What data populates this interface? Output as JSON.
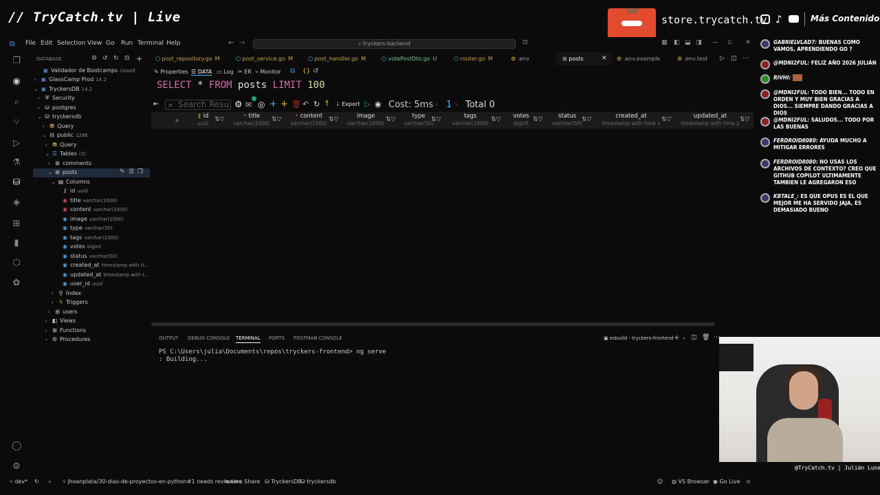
{
  "overlay": {
    "stream_title": "// TryCatch.tv | Live",
    "store_text": "store.trycatch.tv",
    "more_content": "Más Contenido",
    "cam_caption": "@TryCatch.tv | Julián Luna"
  },
  "menu": [
    "File",
    "Edit",
    "Selection",
    "View",
    "Go",
    "Run",
    "Terminal",
    "Help"
  ],
  "search_bar": "tryckers-backend",
  "sidebar": {
    "header": "DATABASE",
    "items": [
      {
        "label": "Validador de Bootcamps",
        "meta": "closed"
      },
      {
        "label": "GlassCamp Prod",
        "meta": "14.2"
      },
      {
        "label": "TryckersDB",
        "meta": "14.2"
      },
      {
        "label": "Security",
        "meta": ""
      },
      {
        "label": "postgres",
        "meta": ""
      },
      {
        "label": "tryckersdb",
        "meta": ""
      },
      {
        "label": "Query",
        "meta": ""
      },
      {
        "label": "public",
        "meta": "128K"
      },
      {
        "label": "Query",
        "meta": ""
      },
      {
        "label": "Tables",
        "meta": "(3)"
      },
      {
        "label": "comments",
        "meta": ""
      },
      {
        "label": "posts",
        "meta": ""
      },
      {
        "label": "Columns",
        "meta": ""
      },
      {
        "label": "id",
        "meta": "uuid"
      },
      {
        "label": "title",
        "meta": "varchar(1000)"
      },
      {
        "label": "content",
        "meta": "varchar(1000)"
      },
      {
        "label": "image",
        "meta": "varchar(1000)"
      },
      {
        "label": "type",
        "meta": "varchar(50)"
      },
      {
        "label": "tags",
        "meta": "varchar(1000)"
      },
      {
        "label": "votes",
        "meta": "bigint"
      },
      {
        "label": "status",
        "meta": "varchar(50)"
      },
      {
        "label": "created_at",
        "meta": "timestamp with ti..."
      },
      {
        "label": "updated_at",
        "meta": "timestamp with t..."
      },
      {
        "label": "user_id",
        "meta": "uuid"
      },
      {
        "label": "Index",
        "meta": ""
      },
      {
        "label": "Triggers",
        "meta": ""
      },
      {
        "label": "users",
        "meta": ""
      },
      {
        "label": "Views",
        "meta": ""
      },
      {
        "label": "Functions",
        "meta": ""
      },
      {
        "label": "Procedures",
        "meta": ""
      }
    ]
  },
  "tabs": [
    {
      "label": "post_repository.go",
      "mod": "M"
    },
    {
      "label": "post_service.go",
      "mod": "M"
    },
    {
      "label": "post_handler.go",
      "mod": "M"
    },
    {
      "label": "votePostDto.go",
      "mod": "U"
    },
    {
      "label": "router.go",
      "mod": "M"
    },
    {
      "label": ".env",
      "mod": ""
    },
    {
      "label": "posts",
      "mod": ""
    },
    {
      "label": ".env.example",
      "mod": ""
    },
    {
      "label": ".env.test",
      "mod": ""
    }
  ],
  "subtabs": [
    "Properties",
    "DATA",
    "Log",
    "ER",
    "Monitor"
  ],
  "sql": {
    "k1": "SELECT",
    "star": "*",
    "k2": "FROM",
    "table": "posts",
    "k3": "LIMIT",
    "limit": "100"
  },
  "result_toolbar": {
    "search_placeholder": "Search Resu",
    "export": "Export",
    "cost": "Cost: 5ms",
    "page": "1",
    "total": "Total 0"
  },
  "columns": [
    {
      "name": "id",
      "type": "uuid"
    },
    {
      "name": "title",
      "type": "varchar(1000)"
    },
    {
      "name": "content",
      "type": "varchar(1000)"
    },
    {
      "name": "image",
      "type": "varchar(1000)"
    },
    {
      "name": "type",
      "type": "varchar(50)"
    },
    {
      "name": "tags",
      "type": "varchar(1000)"
    },
    {
      "name": "votes",
      "type": "bigint"
    },
    {
      "name": "status",
      "type": "varchar(50)"
    },
    {
      "name": "created_at",
      "type": "timestamp with time z"
    },
    {
      "name": "updated_at",
      "type": "timestamp with time z"
    }
  ],
  "panel_tabs": [
    "OUTPUT",
    "DEBUG CONSOLE",
    "TERMINAL",
    "PORTS",
    "POSTMAN CONSOLE"
  ],
  "terminal": {
    "session": "esbuild - tryckers-frontend",
    "line1": "PS C:\\Users\\julia\\Documents\\repos\\tryckers-frontend> ng serve",
    "line2": ": Building..."
  },
  "statusbar": {
    "remote": "dev*",
    "branch_pr": "jhoanplata/30-dias-de-proyectos-en-python#1 needs reviewers",
    "live_share": "Live Share",
    "db1": "TryckersDB",
    "db2": "tryckersdb",
    "vs_browser": "VS Browser",
    "go_live": "Go Live"
  },
  "chat": [
    {
      "user": "GABRIELVLAD7:",
      "text": "BUENAS COMO VAMOS, APRENDIENDO GO ?"
    },
    {
      "user": "@MDNI2FUL:",
      "text": "FELIZ AÑO 2026 JULIÁN"
    },
    {
      "user": "RIVHI:",
      "text": ""
    },
    {
      "user": "@MDNI2FUL:",
      "text": "TODO BIEN... TODO EN ORDEN Y MUY BIEN GRACIAS A DIOS... SIEMPRE DANDO GRACIAS A DIOS"
    },
    {
      "user": "@MDNI2FUL:",
      "text": "SALUDOS... TODO POR LAS BUENAS"
    },
    {
      "user": "FERDROID8080:",
      "text": "AYUDA MUCHO A MITIGAR ERRORES"
    },
    {
      "user": "FERDROID8080:",
      "text": "NO USAS LOS ARCHIVOS DE CONTEXTO? CREO QUE GITHUB COPILOT ULTIMAMENTE TAMBIEN LE AGREGARON ESO"
    },
    {
      "user": "KBTALE_:",
      "text": "ES QUE OPUS ES EL QUE MEJOR ME HA SERVIDO JAJA, ES DEMASIADO BUENO"
    }
  ],
  "colors": {
    "accent": "#4fb3ff",
    "tab_modified": "#c9a44b",
    "keyword": "#c586c0"
  },
  "icons": [
    "vscode-icon",
    "files-icon",
    "search-icon",
    "source-control-icon",
    "run-icon",
    "extensions-icon",
    "database-icon",
    "account-icon",
    "gear-icon"
  ]
}
